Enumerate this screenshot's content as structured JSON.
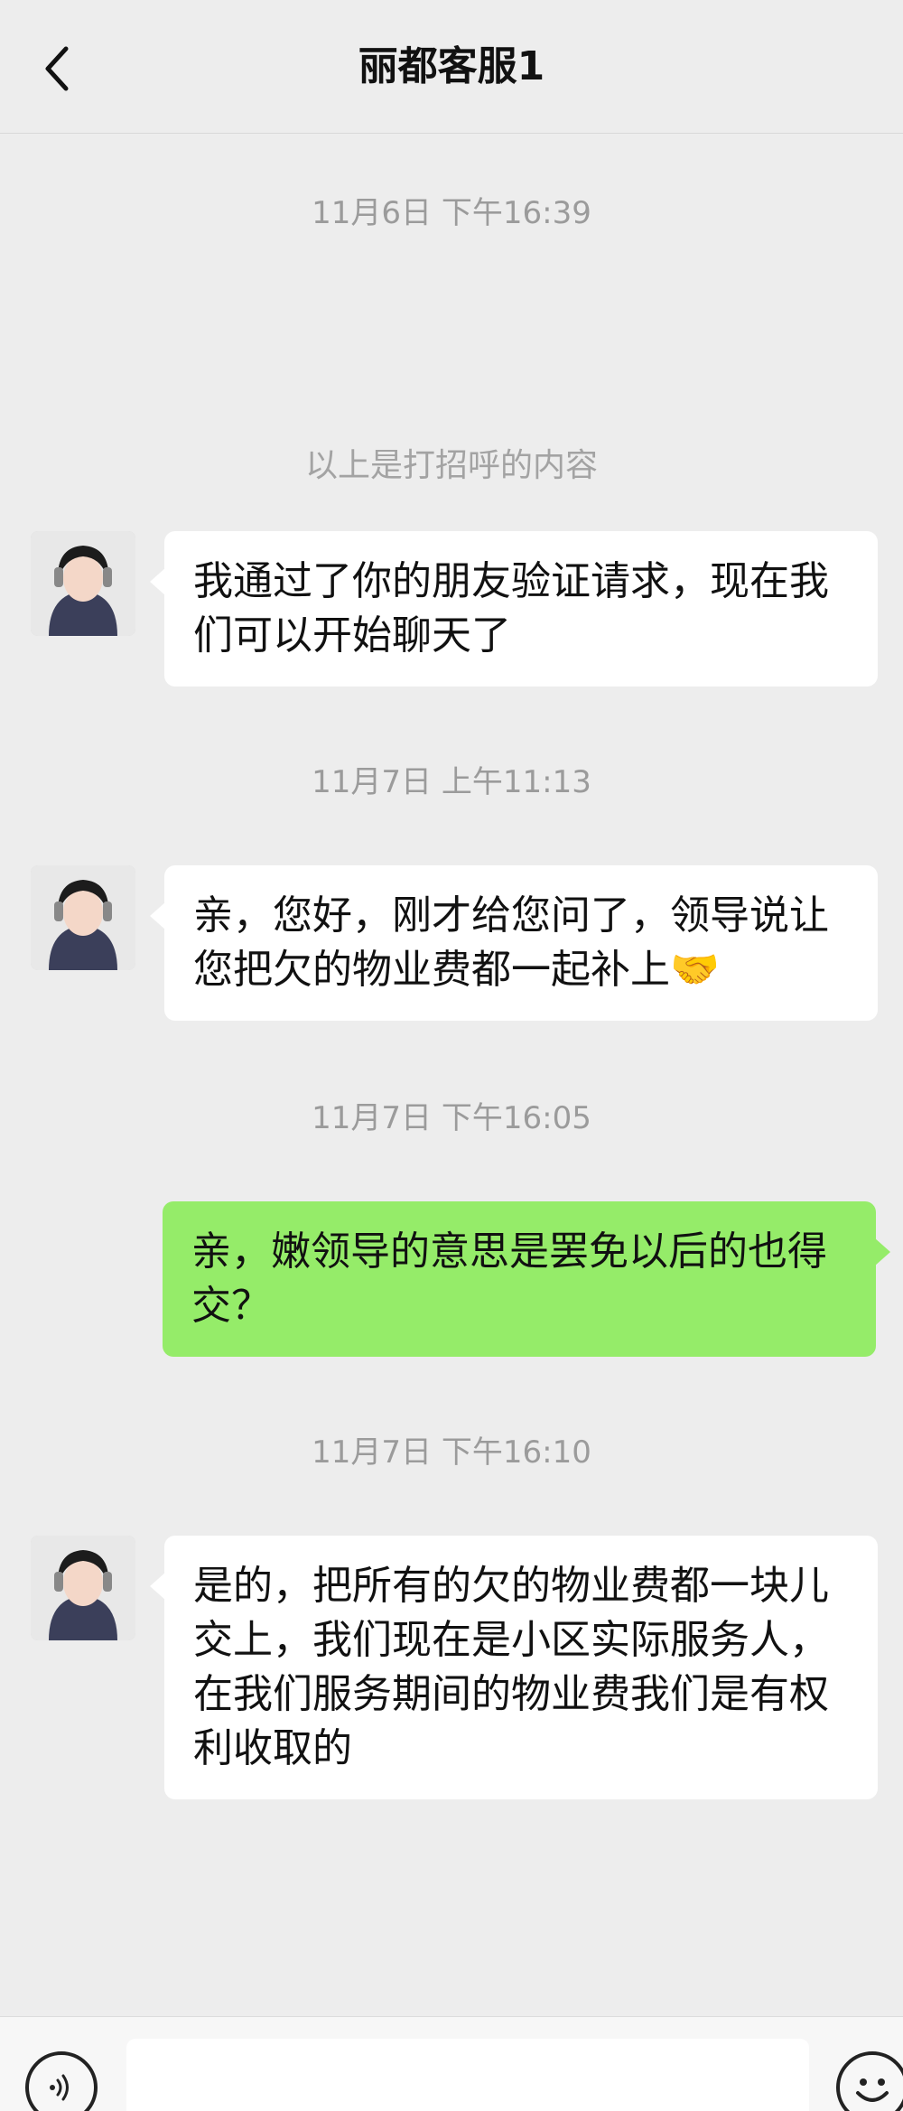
{
  "header": {
    "title": "丽都客服1"
  },
  "messages": [
    {
      "type": "time",
      "text": "11月6日 下午16:39"
    },
    {
      "type": "notice",
      "text": "以上是打招呼的内容"
    },
    {
      "type": "received",
      "text": "我通过了你的朋友验证请求，现在我们可以开始聊天了"
    },
    {
      "type": "time",
      "text": "11月7日 上午11:13"
    },
    {
      "type": "received",
      "text": "亲，您好，刚才给您问了，领导说让您把欠的物业费都一起补上🤝"
    },
    {
      "type": "time",
      "text": "11月7日 下午16:05"
    },
    {
      "type": "sent",
      "text": "亲，嫩领导的意思是罢免以后的也得交？"
    },
    {
      "type": "time",
      "text": "11月7日 下午16:10"
    },
    {
      "type": "received",
      "text": "是的，把所有的欠的物业费都一块儿交上，我们现在是小区实际服务人，在我们服务期间的物业费我们是有权利收取的"
    }
  ],
  "inputbar": {
    "text_value": ""
  },
  "colors": {
    "background": "#ededed",
    "received_bubble": "#ffffff",
    "sent_bubble": "#95ec69"
  },
  "icons": {
    "back": "chevron-left-icon",
    "voice": "voice-icon",
    "emoji": "emoji-icon"
  }
}
